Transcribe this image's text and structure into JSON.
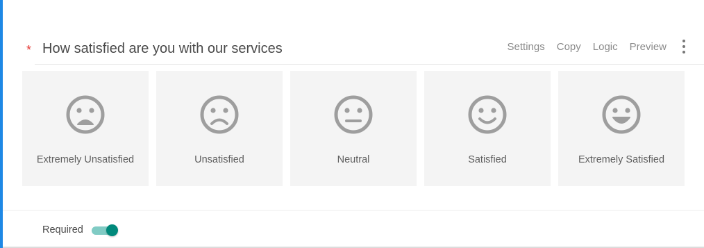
{
  "question": {
    "required_marker": "*",
    "title": "How satisfied are you with our services"
  },
  "actions": {
    "settings": "Settings",
    "copy": "Copy",
    "logic": "Logic",
    "preview": "Preview",
    "more_icon": "kebab-menu-icon"
  },
  "options": [
    {
      "label": "Extremely Unsatisfied",
      "icon": "very-sad-face-icon"
    },
    {
      "label": "Unsatisfied",
      "icon": "sad-face-icon"
    },
    {
      "label": "Neutral",
      "icon": "neutral-face-icon"
    },
    {
      "label": "Satisfied",
      "icon": "happy-face-icon"
    },
    {
      "label": "Extremely Satisfied",
      "icon": "very-happy-face-icon"
    }
  ],
  "footer": {
    "required_label": "Required",
    "required_on": true
  },
  "colors": {
    "accent": "#1e88e5",
    "required_star": "#e53935",
    "toggle_on": "#00897b",
    "toggle_track": "#80cbc4",
    "face": "#9e9e9e"
  }
}
